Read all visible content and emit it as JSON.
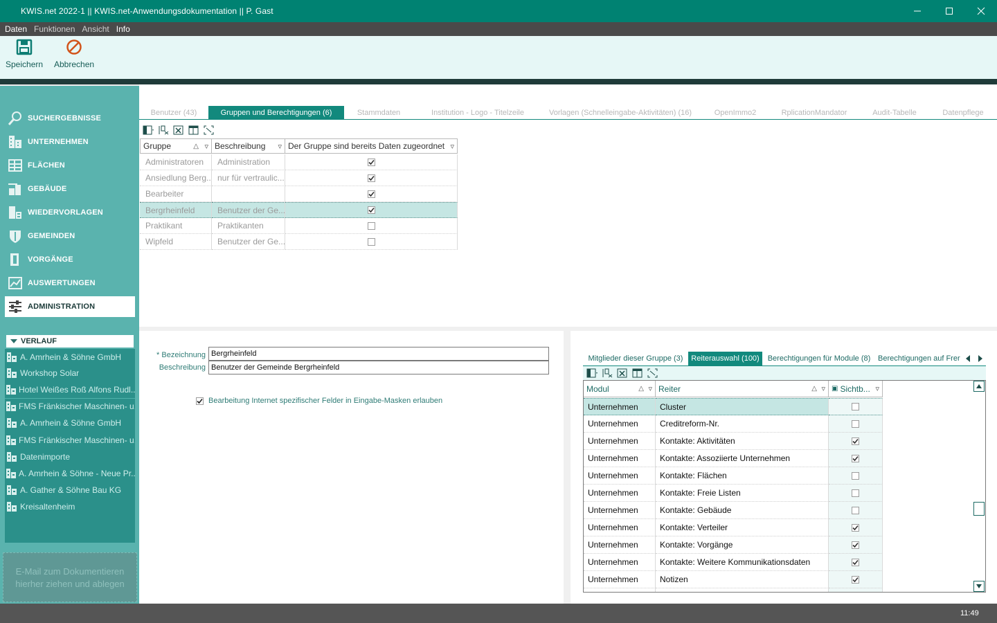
{
  "window": {
    "title": "KWIS.net 2022-1 || KWIS.net-Anwendungsdokumentation || P. Gast"
  },
  "menu": {
    "items": [
      "Daten",
      "Funktionen",
      "Ansicht",
      "Info"
    ]
  },
  "toolbar": {
    "save_label": "Speichern",
    "cancel_label": "Abbrechen"
  },
  "sidebar": {
    "items": [
      {
        "label": "SUCHERGEBNISSE",
        "icon": "search-icon"
      },
      {
        "label": "UNTERNEHMEN",
        "icon": "building-icon"
      },
      {
        "label": "FLÄCHEN",
        "icon": "area-icon"
      },
      {
        "label": "GEBÄUDE",
        "icon": "building-crane-icon"
      },
      {
        "label": "WIEDERVORLAGEN",
        "icon": "calendar-building-icon"
      },
      {
        "label": "GEMEINDEN",
        "icon": "shield-icon"
      },
      {
        "label": "VORGÄNGE",
        "icon": "door-icon"
      },
      {
        "label": "AUSWERTUNGEN",
        "icon": "chart-icon"
      },
      {
        "label": "ADMINISTRATION",
        "icon": "sliders-icon"
      }
    ],
    "verlauf_label": "VERLAUF",
    "verlauf_items": [
      "A. Amrhein & Söhne GmbH",
      "Workshop Solar",
      "Hotel Weißes Roß Alfons Rudl...",
      "FMS Fränkischer Maschinen- u...",
      "A. Amrhein & Söhne GmbH",
      "FMS Fränkischer Maschinen- u...",
      "Datenimporte",
      "A. Amrhein & Söhne - Neue Pr...",
      "A. Gather & Söhne Bau KG",
      "Kreisaltenheim"
    ],
    "dropzone_text": "E-Mail zum Dokumentieren hierher ziehen und ablegen"
  },
  "tabs": [
    "Benutzer (43)",
    "Gruppen und Berechtigungen (6)",
    "Stammdaten",
    "Institution - Logo - Titelzeile",
    "Vorlagen (Schnelleingabe-Aktivitäten) (16)",
    "OpenImmo2",
    "RplicationMandator",
    "Audit-Tabelle",
    "Datenpflege"
  ],
  "groups_table": {
    "headers": [
      "Gruppe",
      "Beschreibung",
      "Der Gruppe sind bereits Daten zugeordnet"
    ],
    "rows": [
      {
        "gruppe": "Administratoren",
        "beschreibung": "Administration",
        "checked": true
      },
      {
        "gruppe": "Ansiedlung Berg...",
        "beschreibung": "nur für vertraulic...",
        "checked": true
      },
      {
        "gruppe": "Bearbeiter",
        "beschreibung": "",
        "checked": true
      },
      {
        "gruppe": "Bergrheinfeld",
        "beschreibung": "Benutzer der Ge...",
        "checked": true
      },
      {
        "gruppe": "Praktikant",
        "beschreibung": "Praktikanten",
        "checked": false
      },
      {
        "gruppe": "Wipfeld",
        "beschreibung": "Benutzer der Ge...",
        "checked": false
      }
    ],
    "selected_index": 3
  },
  "form": {
    "bezeichnung_label": "* Bezeichnung",
    "bezeichnung_value": "Bergrheinfeld",
    "beschreibung_label": "Beschreibung",
    "beschreibung_value": "Benutzer der Gemeinde Bergrheinfeld",
    "checkbox_label": "Bearbeitung Internet spezifischer Felder in Eingabe-Masken erlauben",
    "checkbox_checked": true
  },
  "subtabs": [
    "Mitglieder dieser Gruppe (3)",
    "Reiterauswahl (100)",
    "Berechtigungen für Module (8)",
    "Berechtigungen auf Frer"
  ],
  "tabs_table": {
    "headers": [
      "Modul",
      "Reiter",
      "Sichtb..."
    ],
    "rows": [
      {
        "modul": "Unternehmen",
        "reiter": "Cluster",
        "checked": false
      },
      {
        "modul": "Unternehmen",
        "reiter": "Creditreform-Nr.",
        "checked": false
      },
      {
        "modul": "Unternehmen",
        "reiter": "Kontakte: Aktivitäten",
        "checked": true
      },
      {
        "modul": "Unternehmen",
        "reiter": "Kontakte: Assoziierte Unternehmen",
        "checked": true
      },
      {
        "modul": "Unternehmen",
        "reiter": "Kontakte: Flächen",
        "checked": false
      },
      {
        "modul": "Unternehmen",
        "reiter": "Kontakte: Freie Listen",
        "checked": false
      },
      {
        "modul": "Unternehmen",
        "reiter": "Kontakte: Gebäude",
        "checked": false
      },
      {
        "modul": "Unternehmen",
        "reiter": "Kontakte: Verteiler",
        "checked": true
      },
      {
        "modul": "Unternehmen",
        "reiter": "Kontakte: Vorgänge",
        "checked": true
      },
      {
        "modul": "Unternehmen",
        "reiter": "Kontakte: Weitere Kommunikationsdaten",
        "checked": true
      },
      {
        "modul": "Unternehmen",
        "reiter": "Notizen",
        "checked": true
      }
    ],
    "selected_index": 0
  },
  "status": {
    "time": "11:49"
  },
  "colors": {
    "accent": "#008272",
    "sidebar": "#5ab3ae",
    "selection": "#c5e6e3"
  }
}
